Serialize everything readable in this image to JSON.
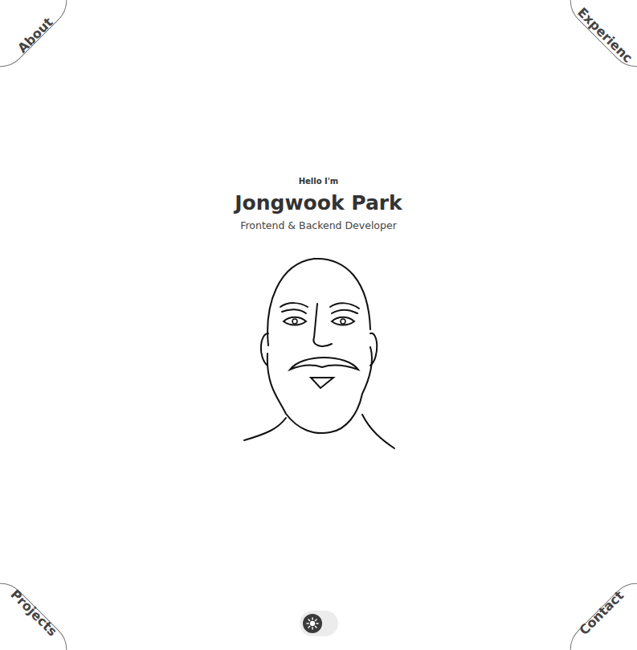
{
  "nav": [
    {
      "label": "About"
    },
    {
      "label": "Experienc"
    },
    {
      "label": "Projects"
    },
    {
      "label": "Contact"
    }
  ],
  "hero": {
    "greeting": "Hello I'm",
    "name": "Jongwook Park",
    "role": "Frontend & Backend Developer"
  },
  "theme_toggle": {
    "dark": false
  }
}
